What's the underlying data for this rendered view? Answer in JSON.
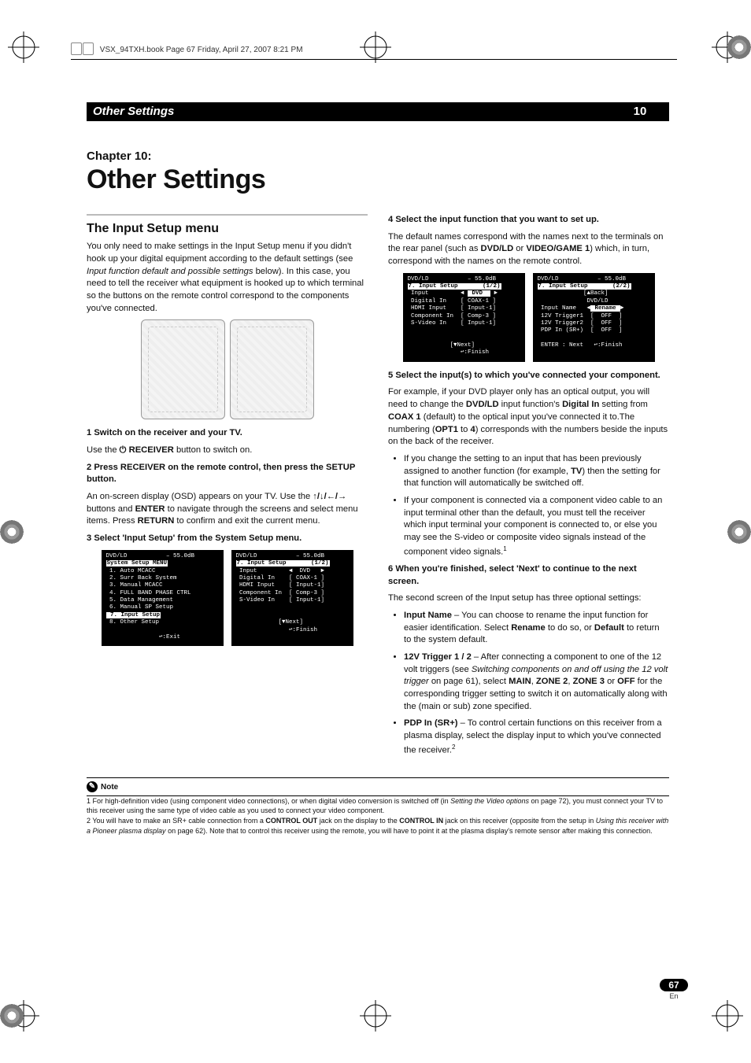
{
  "book_header": "VSX_94TXH.book  Page 67  Friday, April 27, 2007  8:21 PM",
  "section_bar_title": "Other Settings",
  "section_bar_number": "10",
  "chapter_label": "Chapter 10:",
  "chapter_title": "Other Settings",
  "left": {
    "heading": "The Input Setup menu",
    "intro": "You only need to make settings in the Input Setup menu if you didn't hook up your digital equipment according to the default settings (see ",
    "intro_em": "Input function default and possible settings",
    "intro_tail": " below). In this case, you need to tell the receiver what equipment is hooked up to which terminal so the buttons on the remote control correspond to the components you've connected.",
    "step1_head": "1    Switch on the receiver and your TV.",
    "step1_body_a": "Use the ",
    "step1_body_b": " RECEIVER",
    "step1_body_c": " button to switch on.",
    "step2_head": "2    Press RECEIVER on the remote control, then press the SETUP button.",
    "step2_body_a": "An on-screen display (OSD) appears on your TV. Use the ",
    "step2_body_b": " buttons and ",
    "step2_body_c": "ENTER",
    "step2_body_d": " to navigate through the screens and select menu items. Press ",
    "step2_body_e": "RETURN",
    "step2_body_f": " to confirm and exit the current menu.",
    "step3_head": "3    Select 'Input Setup' from the System Setup menu."
  },
  "osd": {
    "sys_title": "DVD/LD           – 55.0dB",
    "sys_menu_hl": "System Setup MENU",
    "sys_items": " 1. Auto MCACC\n 2. Surr Back System\n 3. Manual MCACC\n 4. FULL BAND PHASE CTRL\n 5. Data Management\n 6. Manual SP Setup",
    "sys_item7_hl": " 7. Input Setup",
    "sys_item8": " 8. Other Setup",
    "sys_exit": "               ↩:Exit",
    "in1_title": "DVD/LD           – 55.0dB",
    "in1_hdr_hl": "7. Input Setup       (1/2)",
    "in1_rows": " Input         ◄  DVD   ►\n Digital In    [ COAX-1 ]\n HDMI Input    [ Input-1]\n Component In  [ Comp-3 ]\n S-Video In    [ Input-1]",
    "in1_next": "            [▼Next]\n               ↩:Finish",
    "in2_title": "DVD/LD           – 55.0dB",
    "in2_hdr_hl": "7. Input Setup       (1/2)",
    "in2_rows_a": " Input         ◄ ",
    "in2_rows_a_hl": " DVD  ",
    "in2_rows_a_tail": " ►",
    "in2_rows_b": " Digital In    [ COAX-1 ]\n HDMI Input    [ Input-1]\n Component In  [ Comp-3 ]\n S-Video In    [ Input-1]",
    "in2_next": "            [▼Next]\n               ↩:Finish",
    "p2a_title": "DVD/LD           – 55.0dB",
    "p2a_hdr_hl": "7. Input Setup       (2/2)",
    "p2a_back": "             [▲Back]\n              DVD/LD",
    "p2a_rows_a": " Input Name   ◄",
    "p2a_rows_a_hl": " Rename ",
    "p2a_rows_a_tail": "►",
    "p2a_rows_b": " 12V Trigger1  [  OFF  ]\n 12V Trigger2  [  OFF  ]\n PDP In (SR+)  [  OFF  ]",
    "p2a_enter": " ENTER : Next   ↩:Finish"
  },
  "right": {
    "step4_head": "4    Select the input function that you want to set up.",
    "step4_body_a": "The default names correspond with the names next to the terminals on the rear panel (such as ",
    "step4_body_b": "DVD/LD",
    "step4_body_c": " or ",
    "step4_body_d": "VIDEO/GAME 1",
    "step4_body_e": ") which, in turn, correspond with the names on the remote control.",
    "step5_head": "5    Select the input(s) to which you've connected your component.",
    "step5_body_a": "For example, if your DVD player only has an optical output, you will need to change the ",
    "step5_body_b": "DVD/LD",
    "step5_body_c": " input function's ",
    "step5_body_d": "Digital In",
    "step5_body_e": " setting from ",
    "step5_body_f": "COAX 1",
    "step5_body_g": " (default) to the optical input you've connected it to.The numbering (",
    "step5_body_h": "OPT1",
    "step5_body_i": " to ",
    "step5_body_j": "4",
    "step5_body_k": ") corresponds with the numbers beside the inputs on the back of the receiver.",
    "bul1_a": "If you change the setting to an input that has been previously assigned to another function (for example, ",
    "bul1_b": "TV",
    "bul1_c": ") then the setting for that function will automatically be switched off.",
    "bul2": "If your component is connected via a component video cable to an input terminal other than the default, you must tell the receiver which input terminal your component is connected to, or else you may see the S-video or composite video signals instead of the component video signals.",
    "step6_head": "6    When you're finished, select 'Next' to continue to the next screen.",
    "step6_body": "The second screen of the Input setup has three optional settings:",
    "opt1_label": "Input Name",
    "opt1_text_a": " – You can choose to rename the input function for easier identification. Select ",
    "opt1_text_b": "Rename",
    "opt1_text_c": " to do so, or ",
    "opt1_text_d": "Default",
    "opt1_text_e": " to return to the system default.",
    "opt2_label": "12V Trigger 1 / 2",
    "opt2_text_a": " – After connecting a component to one of the 12 volt triggers (see ",
    "opt2_text_em": "Switching components on and off using the 12 volt trigger",
    "opt2_text_b": " on page 61), select ",
    "opt2_text_c": "MAIN",
    "opt2_text_d": "ZONE 2",
    "opt2_text_e": "ZONE 3",
    "opt2_text_f": " or ",
    "opt2_text_g": "OFF",
    "opt2_text_h": " for the corresponding trigger setting to switch it on automatically along with the (main or sub) zone specified.",
    "opt3_label": "PDP In (SR+)",
    "opt3_text": " – To control certain functions on this receiver from a plasma display, select the display input to which you've connected the receiver."
  },
  "note_label": "Note",
  "footnote1_a": "1  For high-definition video (using component video connections), or when digital video conversion is switched off (in ",
  "footnote1_em": "Setting the Video options",
  "footnote1_b": " on page 72), you must connect your TV to this receiver using the same type of video cable as you used to connect your video component.",
  "footnote2_a": "2  You will have to make an SR+ cable connection from a ",
  "footnote2_b": "CONTROL OUT",
  "footnote2_c": " jack on the display to the ",
  "footnote2_d": "CONTROL IN",
  "footnote2_e": " jack on this receiver (opposite from the setup in ",
  "footnote2_em": "Using this receiver with a Pioneer plasma display",
  "footnote2_f": " on page 62). Note that to control this receiver using the remote, you will have to point it at the plasma display's remote sensor after making this connection.",
  "page_number": "67",
  "page_lang": "En"
}
